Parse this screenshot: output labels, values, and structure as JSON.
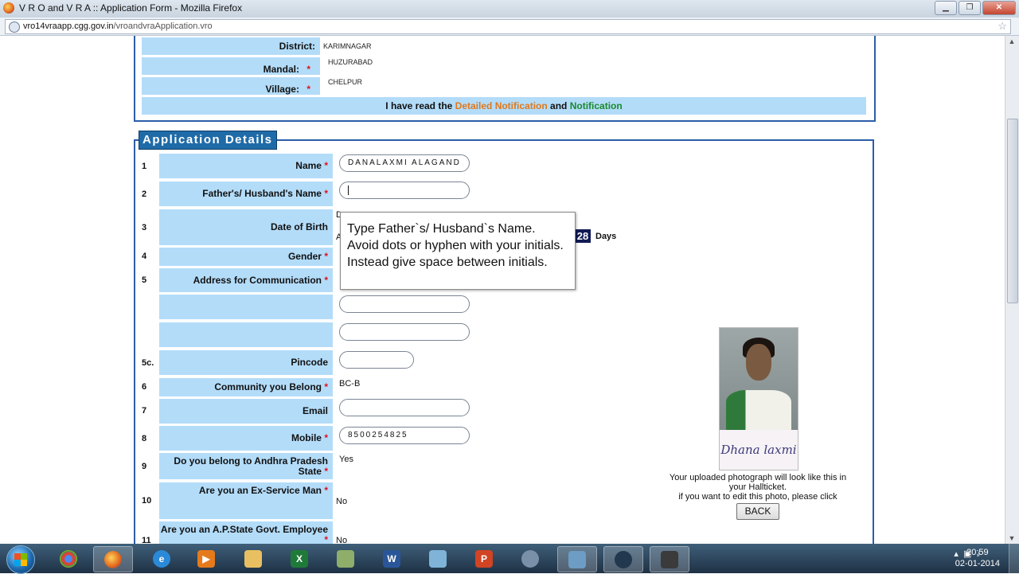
{
  "window": {
    "title": "V R O and V R A :: Application Form - Mozilla Firefox"
  },
  "browser": {
    "url_domain": "vro14vraapp.cgg.gov.in",
    "url_path": "/vroandvraApplication.vro"
  },
  "location": {
    "district_label": "District:",
    "district_value": "KARIMNAGAR",
    "mandal_label": "Mandal:",
    "mandal_value": "HUZURABAD",
    "village_label": "Village:",
    "village_value": "CHELPUR",
    "req": "*"
  },
  "notice": {
    "prefix": "I have read the ",
    "link1": "Detailed Notification",
    "middle": " and ",
    "link2": "Notification"
  },
  "section": {
    "legend": "Application Details"
  },
  "fields": [
    {
      "num": "1",
      "label": "Name",
      "value": "DANALAXMI ALAGAND"
    },
    {
      "num": "2",
      "label": "Father's/ Husband's Name",
      "value": ""
    },
    {
      "num": "3",
      "label": "Date of Birth"
    },
    {
      "num": "4",
      "label": "Gender"
    },
    {
      "num": "5",
      "label": "Address for Communication"
    },
    {
      "num": "5c.",
      "label": "Pincode"
    },
    {
      "num": "6",
      "label": "Community you Belong",
      "value": "BC-B"
    },
    {
      "num": "7",
      "label": "Email"
    },
    {
      "num": "8",
      "label": "Mobile",
      "value": "8500254825"
    },
    {
      "num": "9",
      "label": "Do you belong to Andhra Pradesh State",
      "value": "Yes"
    },
    {
      "num": "10",
      "label": "Are you an Ex-Service Man",
      "value": "No"
    },
    {
      "num": "11",
      "label": "Are you an A.P.State Govt. Employee",
      "value": "No"
    }
  ],
  "dob": {
    "days_value": "28",
    "days_label": "Days",
    "partial_d": "D",
    "partial_a": "A"
  },
  "tooltip": {
    "text": "Type Father`s/ Husband`s Name. Avoid dots or hyphen with your initials. Instead give space between initials."
  },
  "photo": {
    "signature": "Dhana laxmi",
    "caption_1": "Your uploaded photograph will look like this in",
    "caption_2": "your Hallticket.",
    "caption_3": "if you want to edit this photo, please click",
    "back_label": "BACK"
  },
  "taskbar": {
    "time": "20:59",
    "date": "02-01-2014"
  },
  "colors": {
    "label_bg": "#b3dcf9",
    "border_blue": "#2c5ea8",
    "required": "#e0121f",
    "link_orange": "#e0781b",
    "link_green": "#1a8a2a"
  }
}
